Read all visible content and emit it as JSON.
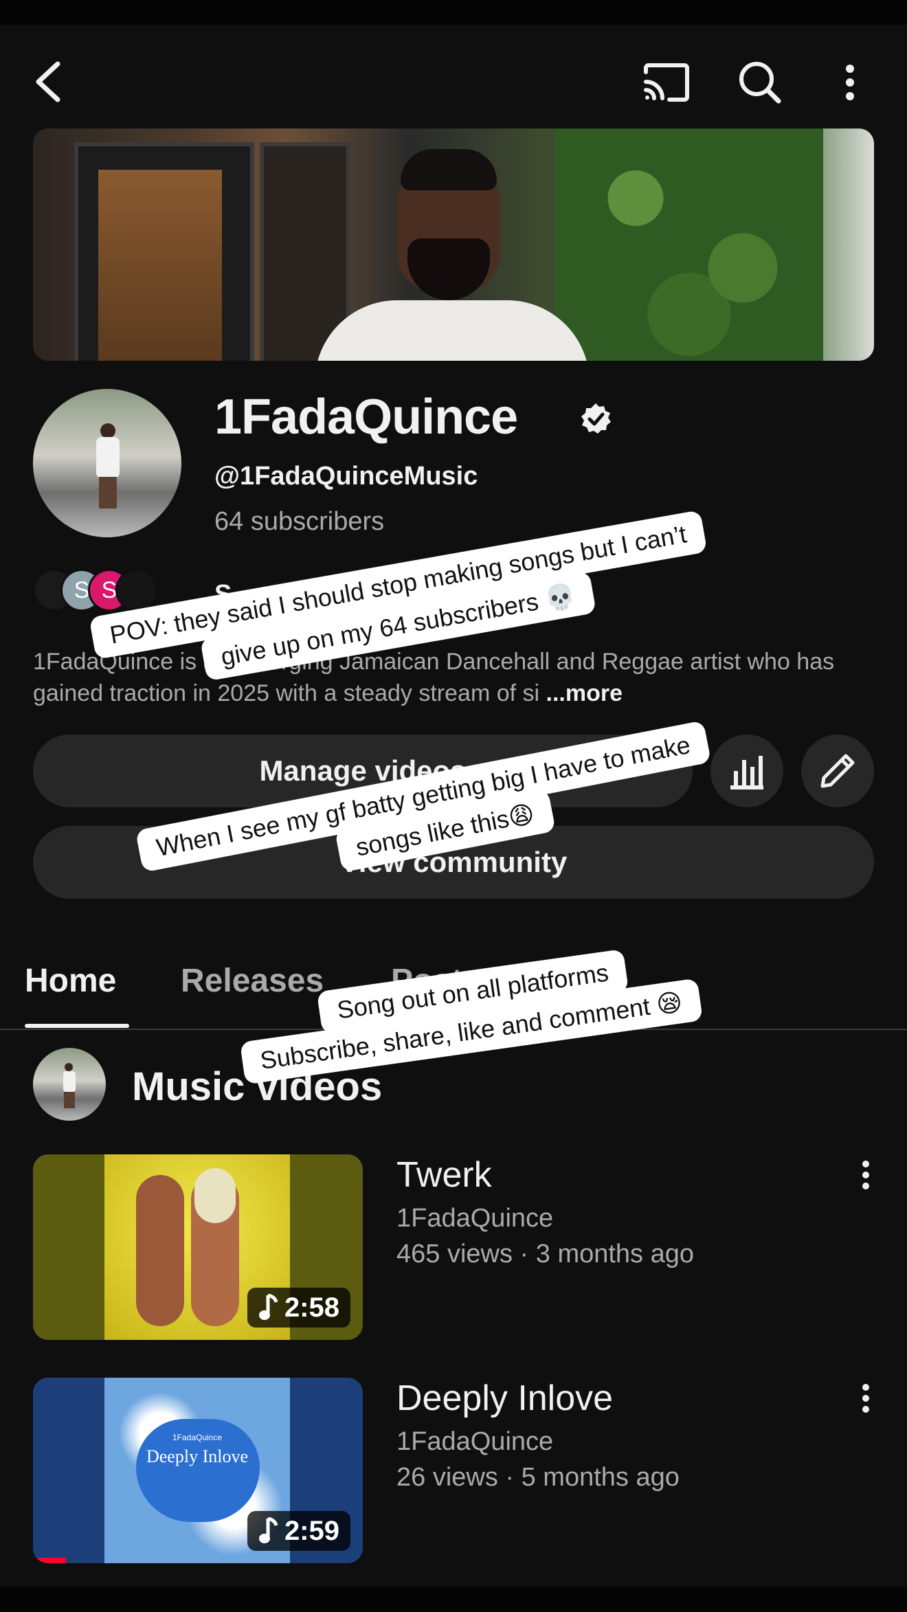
{
  "channel": {
    "name": "1FadaQuince",
    "handle": "@1FadaQuinceMusic",
    "subscribers": "64 subscribers",
    "description": "1FadaQuince is an emerging Jamaican Dancehall and Reggae artist who has gained traction in 2025 with a steady stream of si",
    "more_label": "...more",
    "subscribed_by_partial": "S"
  },
  "subscriber_avatars": [
    {
      "letter": "",
      "color": "#1a1a1a"
    },
    {
      "letter": "S",
      "color": "#8fa3ad"
    },
    {
      "letter": "S",
      "color": "#d8196e"
    },
    {
      "letter": "",
      "color": "#151515"
    }
  ],
  "actions": {
    "manage_videos": "Manage videos",
    "view_community": "View community"
  },
  "tabs": [
    {
      "label": "Home",
      "active": true
    },
    {
      "label": "Releases",
      "active": false
    },
    {
      "label": "Posts",
      "active": false
    }
  ],
  "section": {
    "title": "Music videos"
  },
  "videos": [
    {
      "title": "Twerk",
      "channel": "1FadaQuince",
      "meta": "465 views · 3 months ago",
      "duration": "2:58"
    },
    {
      "title": "Deeply Inlove",
      "channel": "1FadaQuince",
      "meta": "26 views · 5 months ago",
      "duration": "2:59",
      "thumb_text": "Deeply Inlove",
      "thumb_small": "1FadaQuince"
    }
  ],
  "overlays": {
    "cap1_line1": "POV: they said I should stop making songs but I can’t",
    "cap1_line2": "give up on my 64 subscribers 💀",
    "cap2_line1": "When I see my gf batty getting big I have to make",
    "cap2_line2": "songs like this😩",
    "cap3_line1": "Song out on all platforms",
    "cap3_line2": "Subscribe, share, like and comment 😪"
  },
  "icons": {
    "back": "back-arrow-icon",
    "cast": "cast-icon",
    "search": "search-icon",
    "more": "more-vert-icon",
    "verified": "verified-icon",
    "stats": "stats-icon",
    "edit": "pencil-icon",
    "music": "music-note-icon"
  }
}
